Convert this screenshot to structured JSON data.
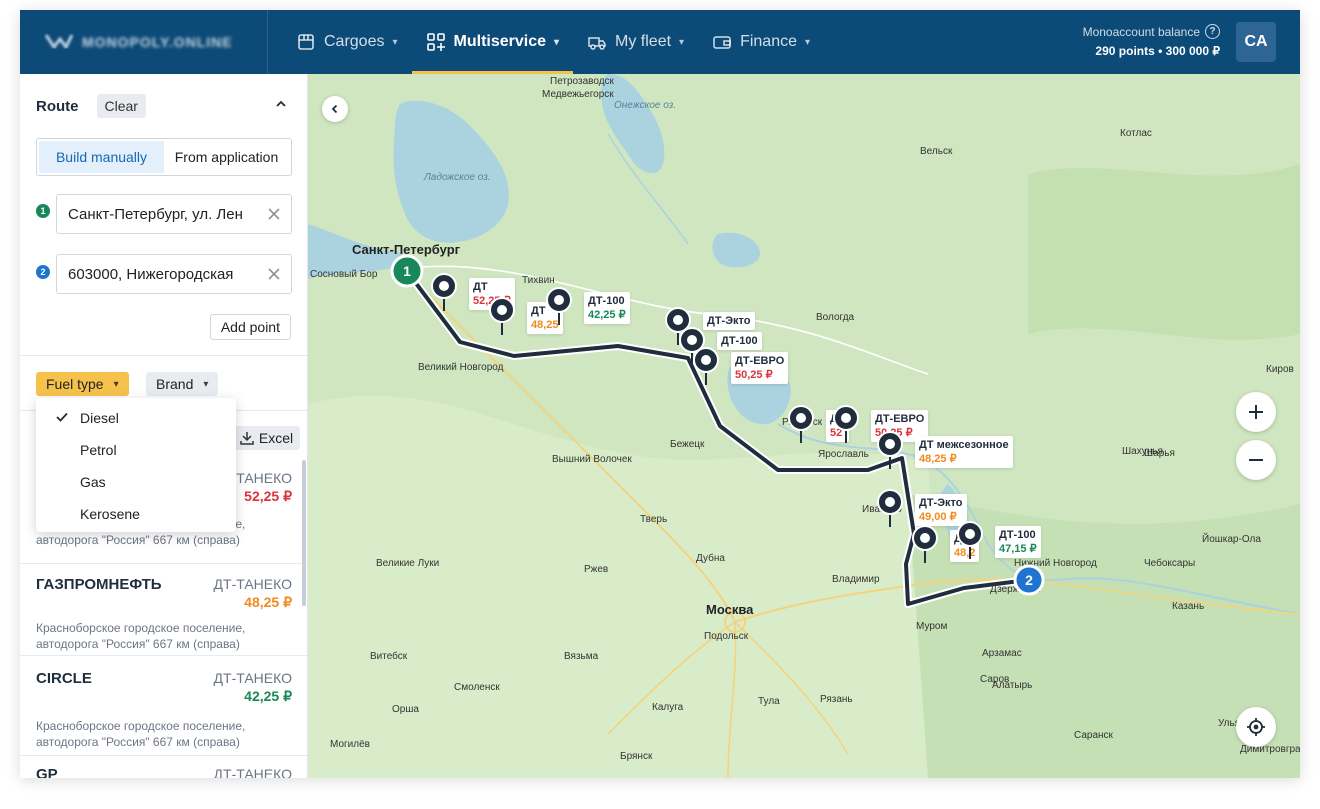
{
  "header": {
    "logo_text": "MONOPOLY.ONLINE",
    "nav": [
      {
        "label": "Cargoes",
        "icon": "box-icon",
        "active": false
      },
      {
        "label": "Multiservice",
        "icon": "grid-plus-icon",
        "active": true
      },
      {
        "label": "My fleet",
        "icon": "truck-icon",
        "active": false
      },
      {
        "label": "Finance",
        "icon": "wallet-icon",
        "active": false
      }
    ],
    "balance_label": "Monoaccount balance",
    "balance_value": "290 points • 300 000 ₽",
    "avatar": "CA"
  },
  "sidebar": {
    "route_title": "Route",
    "clear_label": "Clear",
    "mode_tabs": [
      "Build manually",
      "From application"
    ],
    "points": [
      {
        "number": "1",
        "value": "Санкт-Петербург, ул. Лен",
        "color": "#18885a"
      },
      {
        "number": "2",
        "value": "603000, Нижегородская",
        "color": "#1f74d0"
      }
    ],
    "add_point_label": "Add point",
    "filters": {
      "fuel_type": "Fuel type",
      "brand": "Brand"
    },
    "fuel_options": [
      {
        "label": "Diesel",
        "checked": true
      },
      {
        "label": "Petrol",
        "checked": false
      },
      {
        "label": "Gas",
        "checked": false
      },
      {
        "label": "Kerosene",
        "checked": false
      }
    ],
    "excel_label": "Excel",
    "stations": [
      {
        "brand": "",
        "fuel": "ДТ-ТАНЕКО",
        "price": "52,25 ₽",
        "price_color": "red",
        "address": "Красноборское городское поселение, автодорога \"Россия\" 667 км (справа)"
      },
      {
        "brand": "ГАЗПРОМНЕФТЬ",
        "fuel": "ДТ-ТАНЕКО",
        "price": "48,25 ₽",
        "price_color": "orange",
        "address": "Красноборское городское поселение, автодорога \"Россия\" 667 км (справа)"
      },
      {
        "brand": "CIRCLE",
        "fuel": "ДТ-ТАНЕКО",
        "price": "42,25 ₽",
        "price_color": "green",
        "address": "Красноборское городское поселение, автодорога \"Россия\" 667 км (справа)"
      },
      {
        "brand": "GP",
        "fuel": "ДТ-ТАНЕКО",
        "price": "",
        "price_color": "green",
        "address": ""
      }
    ]
  },
  "map": {
    "cities": [
      {
        "name": "Петрозаводск",
        "size": "small"
      },
      {
        "name": "Медвежьегорск",
        "size": "small"
      },
      {
        "name": "Онежское оз.",
        "size": "water"
      },
      {
        "name": "Котлас",
        "size": "small"
      },
      {
        "name": "Вельск",
        "size": "small"
      },
      {
        "name": "Ладожское оз.",
        "size": "water"
      },
      {
        "name": "Санкт-Петербург",
        "size": "big"
      },
      {
        "name": "Сосновый Бор",
        "size": "small"
      },
      {
        "name": "Тихвин",
        "size": "small"
      },
      {
        "name": "Вологда",
        "size": "small"
      },
      {
        "name": "Великий Новгород",
        "size": "small"
      },
      {
        "name": "Рыбинск",
        "size": "small"
      },
      {
        "name": "Ярославль",
        "size": "small"
      },
      {
        "name": "Бежецк",
        "size": "small"
      },
      {
        "name": "Вышний Волочек",
        "size": "small"
      },
      {
        "name": "Шарья",
        "size": "small"
      },
      {
        "name": "Шахунья",
        "size": "small"
      },
      {
        "name": "Киров",
        "size": "small"
      },
      {
        "name": "Тверь",
        "size": "small"
      },
      {
        "name": "Дубна",
        "size": "small"
      },
      {
        "name": "Ржев",
        "size": "small"
      },
      {
        "name": "Великие Луки",
        "size": "small"
      },
      {
        "name": "Владимир",
        "size": "small"
      },
      {
        "name": "Иваново",
        "size": "small"
      },
      {
        "name": "Дзержинск",
        "size": "small"
      },
      {
        "name": "Нижний Новгород",
        "size": "small"
      },
      {
        "name": "Йошкар-Ола",
        "size": "small"
      },
      {
        "name": "Чебоксары",
        "size": "small"
      },
      {
        "name": "Казань",
        "size": "small"
      },
      {
        "name": "Москва",
        "size": "big"
      },
      {
        "name": "Подольск",
        "size": "small"
      },
      {
        "name": "Муром",
        "size": "small"
      },
      {
        "name": "Арзамас",
        "size": "small"
      },
      {
        "name": "Витебск",
        "size": "small"
      },
      {
        "name": "Вязьма",
        "size": "small"
      },
      {
        "name": "Смоленск",
        "size": "small"
      },
      {
        "name": "Калуга",
        "size": "small"
      },
      {
        "name": "Тула",
        "size": "small"
      },
      {
        "name": "Рязань",
        "size": "small"
      },
      {
        "name": "Саров",
        "size": "small"
      },
      {
        "name": "Алатырь",
        "size": "small"
      },
      {
        "name": "Саранск",
        "size": "small"
      },
      {
        "name": "Орша",
        "size": "small"
      },
      {
        "name": "Могилёв",
        "size": "small"
      },
      {
        "name": "Брянск",
        "size": "small"
      },
      {
        "name": "Ульяновск",
        "size": "small"
      },
      {
        "name": "Димитровград",
        "size": "small"
      }
    ],
    "start_marker": "1",
    "end_marker": "2",
    "pins": [
      {
        "name": "ДТ",
        "price": "52,25 ₽",
        "color": "red"
      },
      {
        "name": "ДТ",
        "price": "48,25",
        "color": "orange"
      },
      {
        "name": "ДТ-100",
        "price": "42,25 ₽",
        "color": "green"
      },
      {
        "name": "ДТ-Экто",
        "price": "",
        "color": "red"
      },
      {
        "name": "ДТ-100",
        "price": "",
        "color": "red"
      },
      {
        "name": "ДТ-ЕВРО",
        "price": "50,25 ₽",
        "color": "red"
      },
      {
        "name": "ДТ",
        "price": "52",
        "color": "red"
      },
      {
        "name": "ДТ-ЕВРО",
        "price": "50,25 ₽",
        "color": "red"
      },
      {
        "name": "ДТ межсезонное",
        "price": "48,25 ₽",
        "color": "orange"
      },
      {
        "name": "ДТ-Экто",
        "price": "49,00 ₽",
        "color": "orange"
      },
      {
        "name": "ДТ",
        "price": "48,2",
        "color": "orange"
      },
      {
        "name": "ДТ-100",
        "price": "47,15 ₽",
        "color": "green"
      }
    ]
  },
  "colors": {
    "nav_bg": "#0c4a78",
    "accent": "#f5c24c",
    "route": "#1f2d3d",
    "red": "#d9343d",
    "orange": "#f08b1d",
    "green": "#18885a"
  }
}
